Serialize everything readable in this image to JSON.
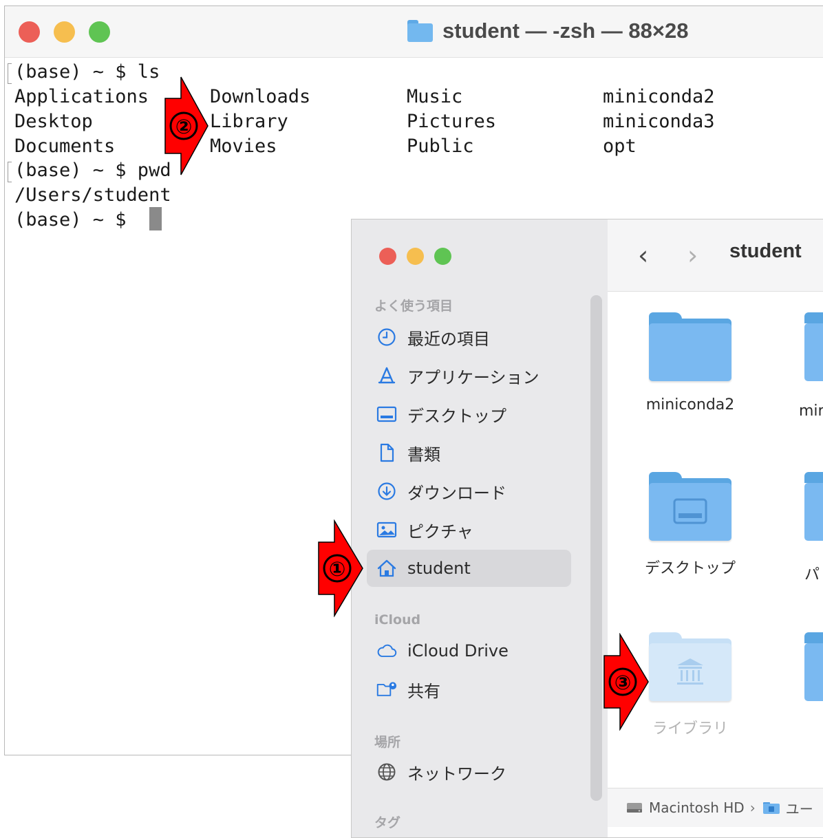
{
  "terminal": {
    "title": "student — -zsh — 88×28",
    "lines": [
      "(base) ~ $ ls",
      "Applications",
      "Downloads",
      "Music",
      "miniconda2",
      "Desktop",
      "Library",
      "Pictures",
      "miniconda3",
      "Documents",
      "Movies",
      "Public",
      "opt",
      "(base) ~ $ pwd",
      "/Users/student",
      "(base) ~ $ "
    ]
  },
  "finder": {
    "title": "student",
    "sidebar": {
      "favorites_header": "よく使う項目",
      "favorites": [
        {
          "label": "最近の項目",
          "icon": "clock-icon"
        },
        {
          "label": "アプリケーション",
          "icon": "applications-icon"
        },
        {
          "label": "デスクトップ",
          "icon": "desktop-icon"
        },
        {
          "label": "書類",
          "icon": "document-icon"
        },
        {
          "label": "ダウンロード",
          "icon": "download-icon"
        },
        {
          "label": "ピクチャ",
          "icon": "photo-icon"
        },
        {
          "label": "student",
          "icon": "home-icon"
        }
      ],
      "icloud_header": "iCloud",
      "icloud": [
        {
          "label": "iCloud Drive",
          "icon": "cloud-icon"
        },
        {
          "label": "共有",
          "icon": "shared-folder-icon"
        }
      ],
      "locations_header": "場所",
      "locations": [
        {
          "label": "ネットワーク",
          "icon": "network-icon"
        }
      ],
      "tags_header": "タグ"
    },
    "items": [
      {
        "label": "miniconda2"
      },
      {
        "label": "デスクトップ"
      },
      {
        "label": "ライブラリ"
      }
    ],
    "partial_labels": [
      "mir",
      "パ"
    ],
    "pathbar": [
      "Macintosh HD",
      "ユー"
    ]
  },
  "annotations": [
    "①",
    "②",
    "③"
  ],
  "colors": {
    "close": "#ec5f57",
    "minimize": "#f6be4f",
    "zoom": "#5fc453",
    "accent": "#2a7ae2",
    "arrow": "#ff0000"
  }
}
